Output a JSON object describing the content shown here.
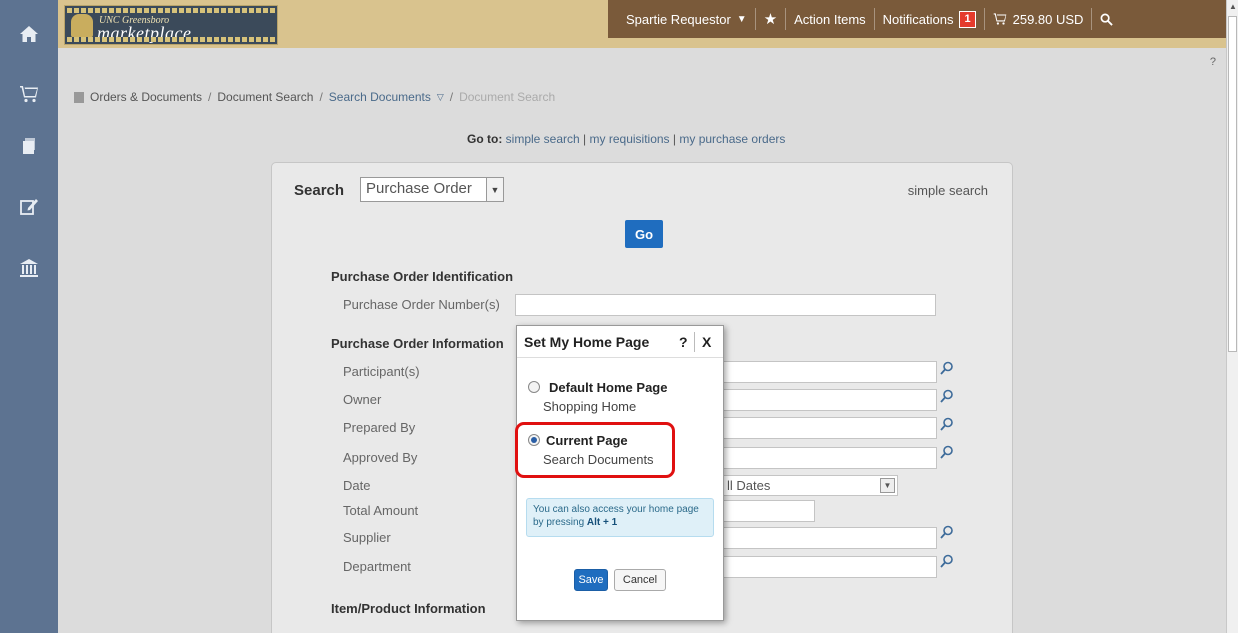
{
  "logo": {
    "subtitle": "UNC Greensboro",
    "main": "marketplace"
  },
  "rail": {
    "icons": [
      "home-icon",
      "cart-icon",
      "documents-icon",
      "edit-icon",
      "bank-icon"
    ]
  },
  "topnav": {
    "user": "Spartie Requestor",
    "action_items": "Action Items",
    "notifications": "Notifications",
    "notification_count": "1",
    "cart_total": "259.80 USD",
    "help": "?"
  },
  "breadcrumb": {
    "items": [
      "Orders & Documents",
      "Document Search",
      "Search Documents",
      "Document Search"
    ],
    "separator": "/"
  },
  "goto": {
    "label": "Go to:",
    "links": [
      "simple search",
      "my requisitions",
      "my purchase orders"
    ],
    "sep": "|"
  },
  "search": {
    "label": "Search",
    "type_value": "Purchase Order",
    "simple_search": "simple search",
    "go_label": "Go"
  },
  "form": {
    "sections": {
      "identification": "Purchase Order Identification",
      "information": "Purchase Order Information",
      "item": "Item/Product Information"
    },
    "fields": {
      "po_number": "Purchase Order Number(s)",
      "participants": "Participant(s)",
      "owner": "Owner",
      "prepared_by": "Prepared By",
      "approved_by": "Approved By",
      "date": "Date",
      "date_value": "ll Dates",
      "total_amount": "Total Amount",
      "supplier": "Supplier",
      "department": "Department"
    }
  },
  "modal": {
    "title": "Set My Home Page",
    "help": "?",
    "close": "X",
    "options": [
      {
        "title": "Default Home Page",
        "subtitle": "Shopping Home",
        "checked": false
      },
      {
        "title": "Current Page",
        "subtitle": "Search Documents",
        "checked": true
      }
    ],
    "info_text": "You can also access your home page by pressing",
    "info_shortcut": "Alt + 1",
    "save_label": "Save",
    "cancel_label": "Cancel"
  },
  "colors": {
    "rail": "#5d7391",
    "topbar": "#d9c38e",
    "topnav": "#7a5a3a",
    "primary_button": "#1f6dbf",
    "highlight": "#e01010",
    "badge": "#e53b2c"
  }
}
